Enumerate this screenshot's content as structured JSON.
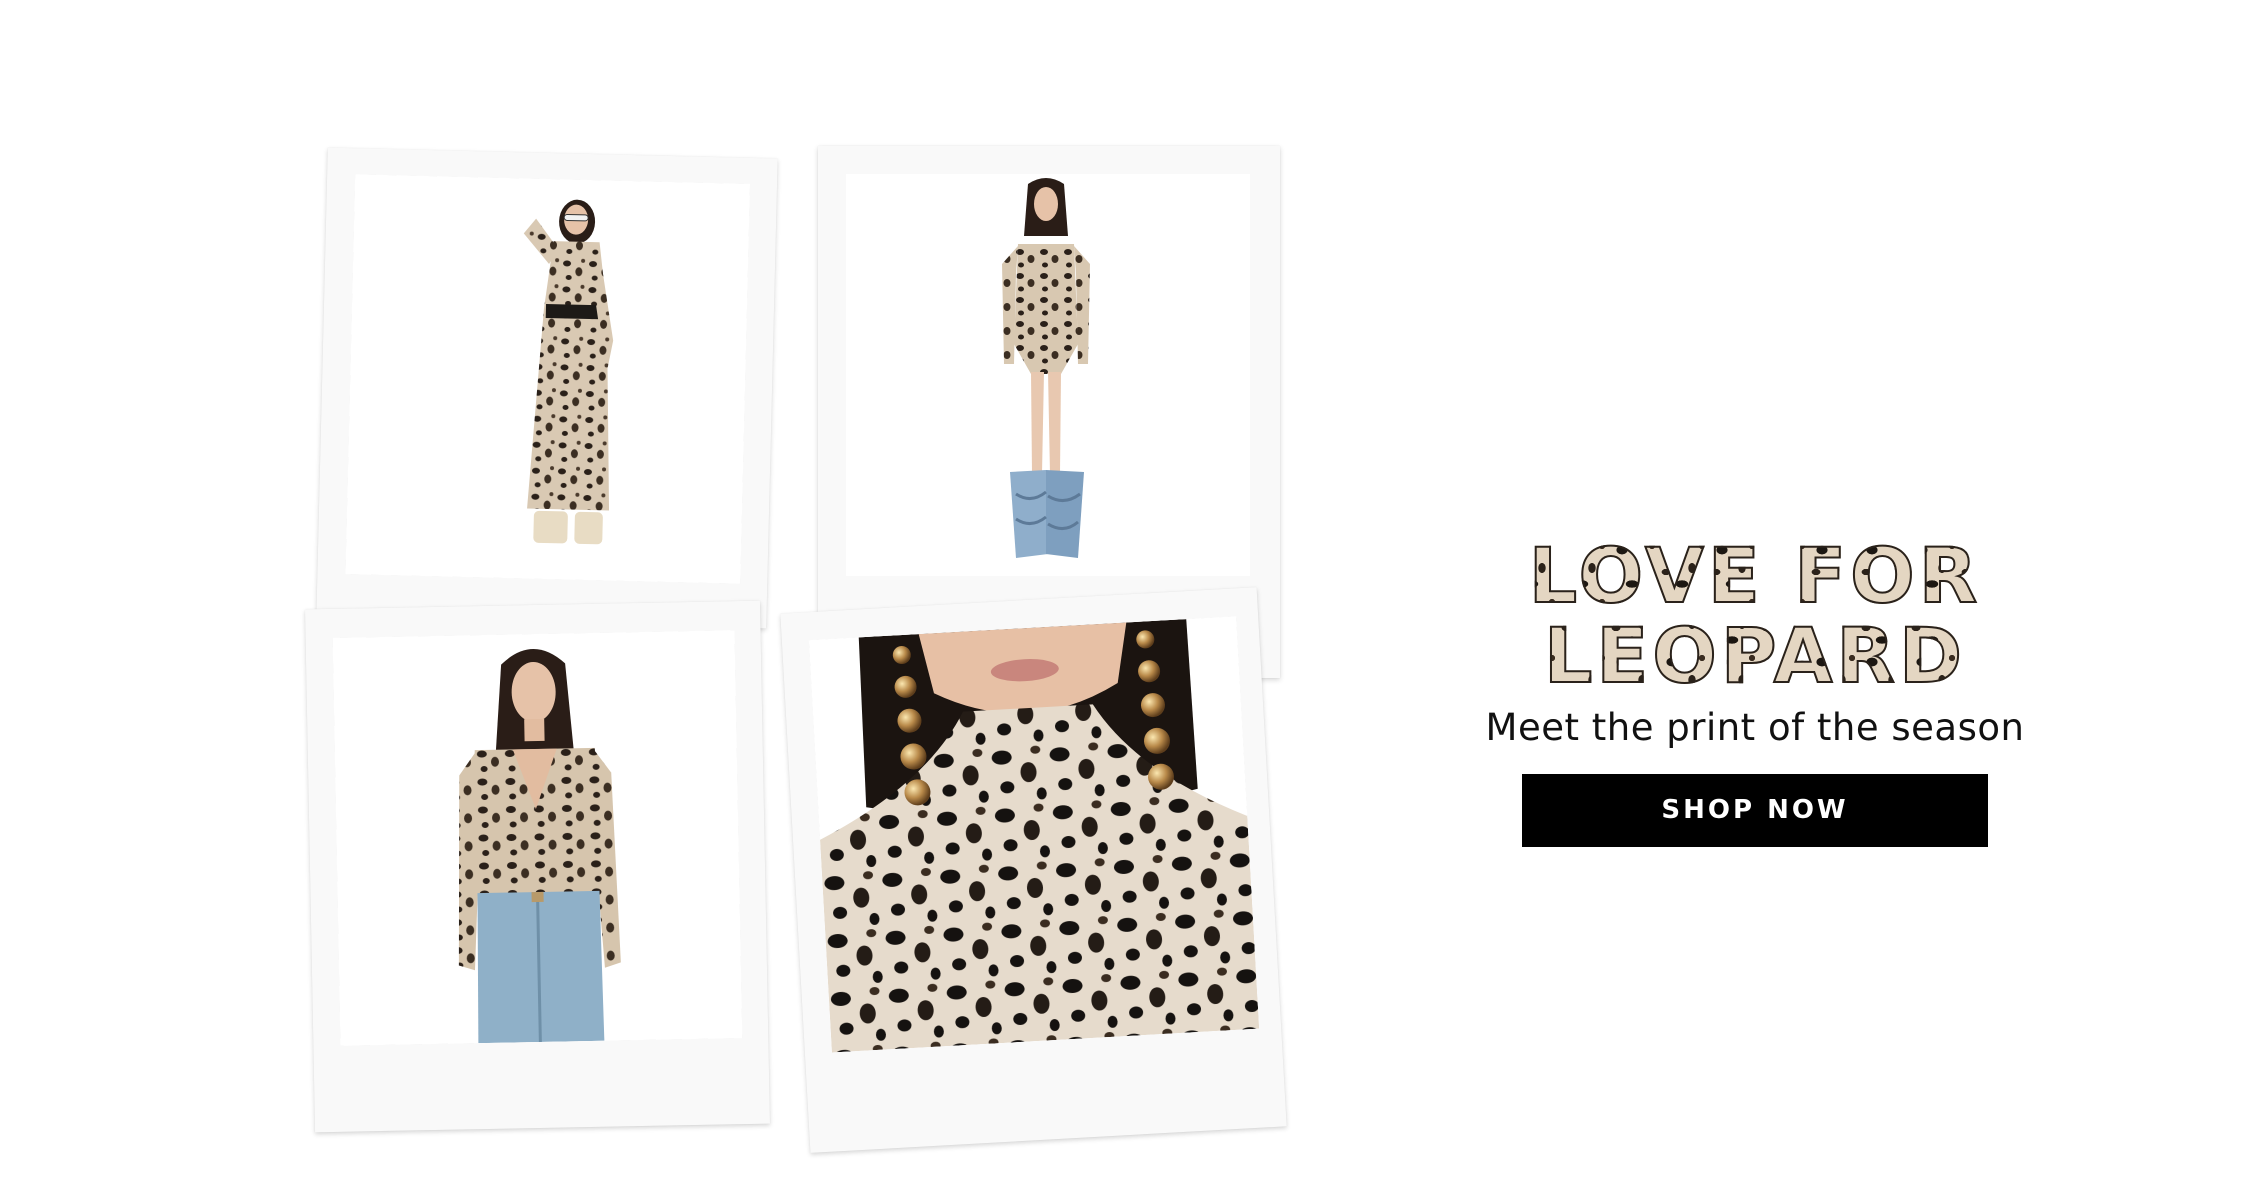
{
  "promo": {
    "headline": "LOVE FOR LEOPARD",
    "subline": "Meet the print of the season",
    "cta_label": "SHOP NOW"
  },
  "colors": {
    "background": "#ffffff",
    "button_bg": "#000000",
    "button_text": "#ffffff",
    "polaroid_frame": "#f9f9f9",
    "leopard_base": "#e4d6c2",
    "leopard_spot": "#1c1712",
    "denim": "#8faecb"
  },
  "gallery": [
    {
      "photo": "model-leopard-maxi-dress"
    },
    {
      "photo": "model-leopard-bodysuit-denim-boots"
    },
    {
      "photo": "model-leopard-bodysuit-jeans"
    },
    {
      "photo": "closeup-leopard-turtleneck-gold-earrings"
    }
  ]
}
